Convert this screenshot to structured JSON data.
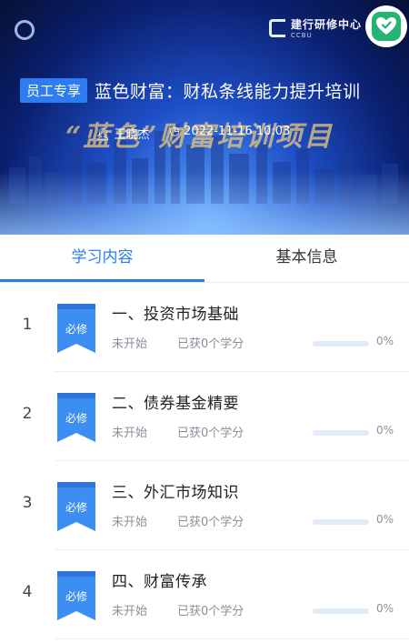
{
  "banner": {
    "bank_logo": "",
    "bank_logo_sub": "",
    "center_logo": "建行研修中心",
    "center_logo_sub": "CCBU",
    "tag": "员工专享",
    "title": "蓝色财富：财私条线能力提升培训",
    "calligraphy": "“蓝色”财富培训项目",
    "author": "王晓杰",
    "datetime": "2022-11-16 10:03"
  },
  "favorite": {
    "icon": "heart-icon",
    "color": "#22b573"
  },
  "tabs": [
    {
      "label": "学习内容",
      "active": true
    },
    {
      "label": "基本信息",
      "active": false
    }
  ],
  "badge_label": "必修",
  "colors": {
    "accent": "#2a7ef1",
    "badge": "#3d8ef2",
    "muted": "#8a8f99"
  },
  "courses": [
    {
      "index": "1",
      "name": "一、投资市场基础",
      "status": "未开始",
      "credits": "已获0个学分",
      "progress": 0,
      "progress_text": "0%"
    },
    {
      "index": "2",
      "name": "二、债券基金精要",
      "status": "未开始",
      "credits": "已获0个学分",
      "progress": 0,
      "progress_text": "0%"
    },
    {
      "index": "3",
      "name": "三、外汇市场知识",
      "status": "未开始",
      "credits": "已获0个学分",
      "progress": 0,
      "progress_text": "0%"
    },
    {
      "index": "4",
      "name": "四、财富传承",
      "status": "未开始",
      "credits": "已获0个学分",
      "progress": 0,
      "progress_text": "0%"
    }
  ]
}
